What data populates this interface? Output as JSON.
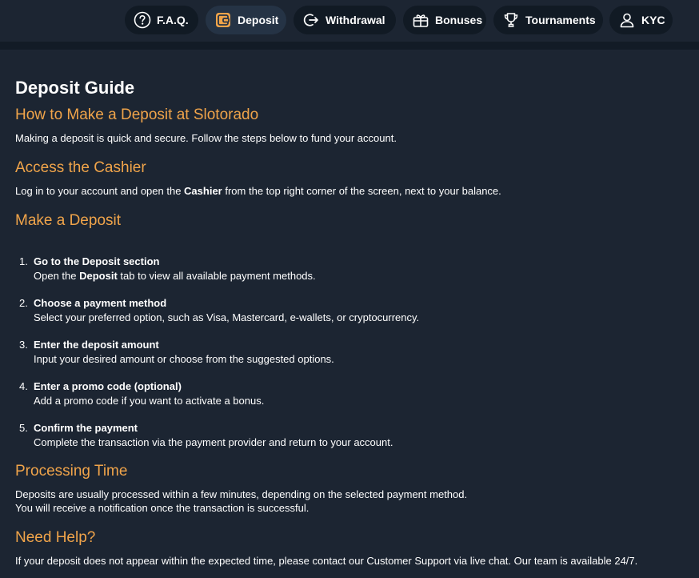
{
  "tabs": [
    {
      "label": "F.A.Q.",
      "icon": "question-circle-icon",
      "active": false
    },
    {
      "label": "Deposit",
      "icon": "wallet-icon",
      "active": true
    },
    {
      "label": "Withdrawal",
      "icon": "withdrawal-icon",
      "active": false
    },
    {
      "label": "Bonuses",
      "icon": "gift-icon",
      "active": false
    },
    {
      "label": "Tournaments",
      "icon": "trophy-icon",
      "active": false
    },
    {
      "label": "KYC",
      "icon": "user-icon",
      "active": false
    }
  ],
  "colors": {
    "background": "#1c2532",
    "accent": "#f0a44a",
    "tab_background": "#111a24",
    "tab_active_background": "#253345",
    "wallet_icon": "#f0a44a"
  },
  "guide": {
    "title": "Deposit Guide",
    "how_heading": "How to Make a Deposit at Slotorado",
    "how_text": "Making a deposit is quick and secure. Follow the steps below to fund your account.",
    "access_heading": "Access the Cashier",
    "access_text_before": "Log in to your account and open the ",
    "access_text_bold": "Cashier",
    "access_text_after": " from the top right corner of the screen, next to your balance.",
    "make_heading": "Make a Deposit",
    "steps": [
      {
        "number": "1.",
        "title": "Go to the Deposit section",
        "desc_before": "Open the ",
        "desc_bold": "Deposit",
        "desc_after": " tab to view all available payment methods."
      },
      {
        "number": "2.",
        "title": "Choose a payment method",
        "desc": "Select your preferred option, such as Visa, Mastercard, e-wallets, or cryptocurrency."
      },
      {
        "number": "3.",
        "title": "Enter the deposit amount",
        "desc": "Input your desired amount or choose from the suggested options."
      },
      {
        "number": "4.",
        "title": "Enter a promo code (optional)",
        "desc": "Add a promo code if you want to activate a bonus."
      },
      {
        "number": "5.",
        "title": "Confirm the payment",
        "desc": "Complete the transaction via the payment provider and return to your account."
      }
    ],
    "processing_heading": "Processing Time",
    "processing_line1": "Deposits are usually processed within a few minutes, depending on the selected payment method.",
    "processing_line2": "You will receive a notification once the transaction is successful.",
    "help_heading": "Need Help?",
    "help_text": "If your deposit does not appear within the expected time, please contact our Customer Support via live chat. Our team is available 24/7."
  }
}
